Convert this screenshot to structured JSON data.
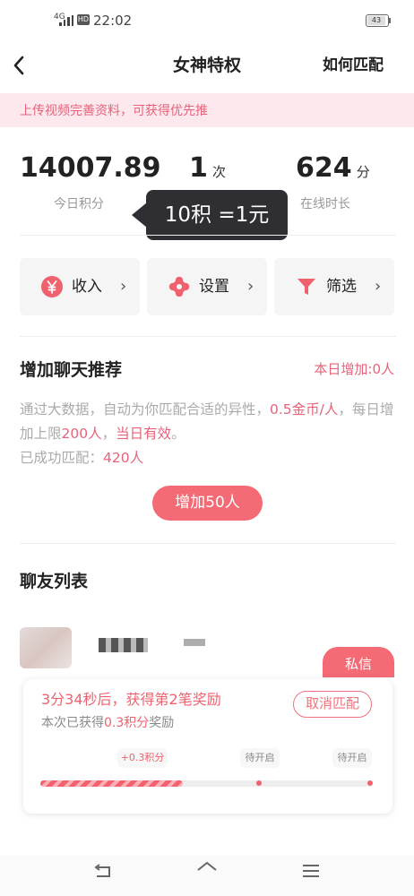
{
  "status_bar": {
    "network": "4G",
    "hd": "HD",
    "time": "22:02",
    "battery": "43"
  },
  "header": {
    "back_icon": "chevron-left-icon",
    "title": "女神特权",
    "help_link": "如何匹配"
  },
  "banner": {
    "text": "上传视频完善资料，可获得优先推"
  },
  "stats": {
    "points": {
      "value": "14007.89",
      "label": "今日积分"
    },
    "matches": {
      "value": "1",
      "unit": "次"
    },
    "online": {
      "value": "624",
      "unit": "分",
      "label": "在线时长"
    }
  },
  "tooltip": {
    "text": "10积 =1元"
  },
  "actions": [
    {
      "label": "收入",
      "icon": "yen-icon"
    },
    {
      "label": "设置",
      "icon": "gear-icon"
    },
    {
      "label": "筛选",
      "icon": "filter-icon"
    }
  ],
  "recommend": {
    "title": "增加聊天推荐",
    "today_added": "本日增加:0人",
    "desc_1": "通过大数据，自动为你匹配合适的异性，",
    "desc_price": "0.5金币/人",
    "desc_2": "，每日增加上限",
    "desc_limit": "200人",
    "desc_3": "，",
    "desc_valid": "当日有效",
    "desc_4": "。",
    "matched_label": "已成功匹配：",
    "matched_count": "420人",
    "button": "增加50人"
  },
  "chat_list": {
    "title": "聊友列表",
    "message_button": "私信"
  },
  "reward_card": {
    "countdown": "3分34秒后，获得第2笔奖励",
    "earned_prefix": "本次已获得",
    "earned_value": "0.3积分",
    "earned_suffix": "奖励",
    "cancel_button": "取消匹配",
    "milestones": [
      "+0.3积分",
      "待开启",
      "待开启"
    ],
    "progress": 0.43
  },
  "colors": {
    "accent": "#f46a75",
    "highlight": "#e8627a",
    "banner_bg": "#fde8ee"
  }
}
